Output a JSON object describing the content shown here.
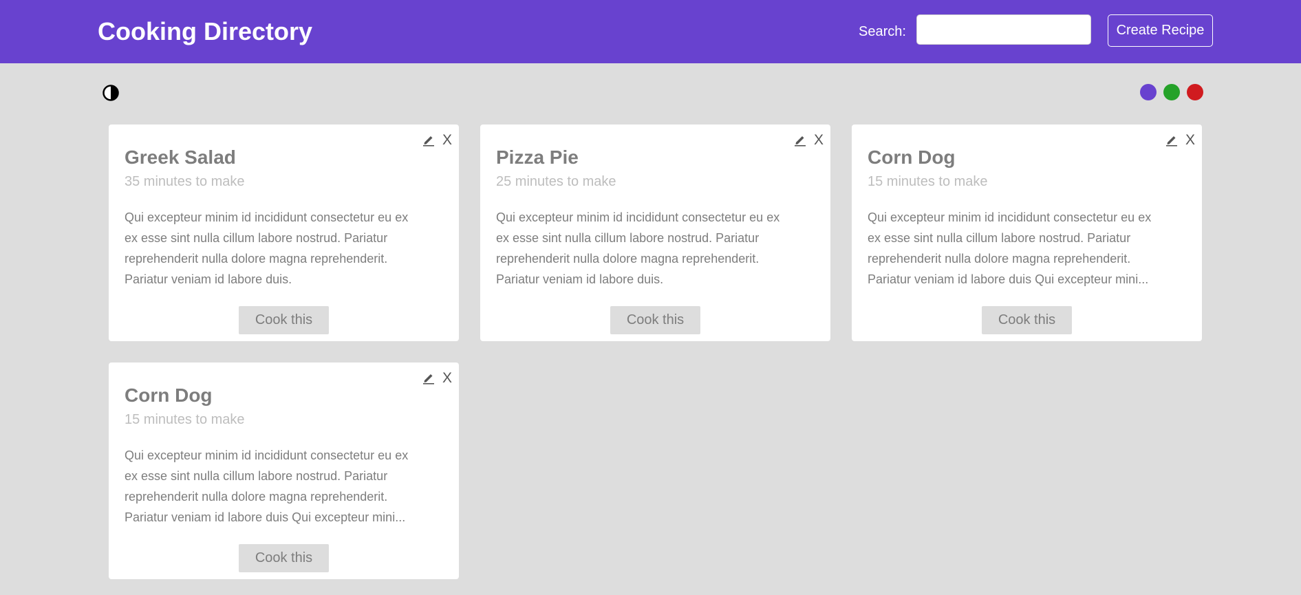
{
  "header": {
    "title": "Cooking Directory",
    "search_label": "Search:",
    "search_value": "",
    "create_label": "Create Recipe",
    "background": "#6842cf"
  },
  "theme_toggle": {
    "icon": "half-circle-contrast-icon"
  },
  "color_swatches": [
    {
      "name": "purple",
      "color": "#6842cf"
    },
    {
      "name": "green",
      "color": "#25a229"
    },
    {
      "name": "red",
      "color": "#d01b1f"
    }
  ],
  "recipes": [
    {
      "title": "Greek Salad",
      "time": "35 minutes to make",
      "description_lines": [
        "Qui excepteur minim id incididunt consectetur eu ex",
        "ex esse sint nulla cillum labore nostrud. Pariatur",
        "reprehenderit nulla dolore magna reprehenderit.",
        "Pariatur veniam id labore duis."
      ],
      "button_label": "Cook this",
      "close_label": "X",
      "edit_icon": "pencil-icon"
    },
    {
      "title": "Pizza Pie",
      "time": "25 minutes to make",
      "description_lines": [
        "Qui excepteur minim id incididunt consectetur eu ex",
        "ex esse sint nulla cillum labore nostrud. Pariatur",
        "reprehenderit nulla dolore magna reprehenderit.",
        "Pariatur veniam id labore duis."
      ],
      "button_label": "Cook this",
      "close_label": "X",
      "edit_icon": "pencil-icon"
    },
    {
      "title": "Corn Dog",
      "time": "15 minutes to make",
      "description_lines": [
        "Qui excepteur minim id incididunt consectetur eu ex",
        "ex esse sint nulla cillum labore nostrud. Pariatur",
        "reprehenderit nulla dolore magna reprehenderit.",
        "Pariatur veniam id labore duis Qui excepteur mini..."
      ],
      "button_label": "Cook this",
      "close_label": "X",
      "edit_icon": "pencil-icon"
    },
    {
      "title": "Corn Dog",
      "time": "15 minutes to make",
      "description_lines": [
        "Qui excepteur minim id incididunt consectetur eu ex",
        "ex esse sint nulla cillum labore nostrud. Pariatur",
        "reprehenderit nulla dolore magna reprehenderit.",
        "Pariatur veniam id labore duis Qui excepteur mini..."
      ],
      "button_label": "Cook this",
      "close_label": "X",
      "edit_icon": "pencil-icon"
    }
  ]
}
